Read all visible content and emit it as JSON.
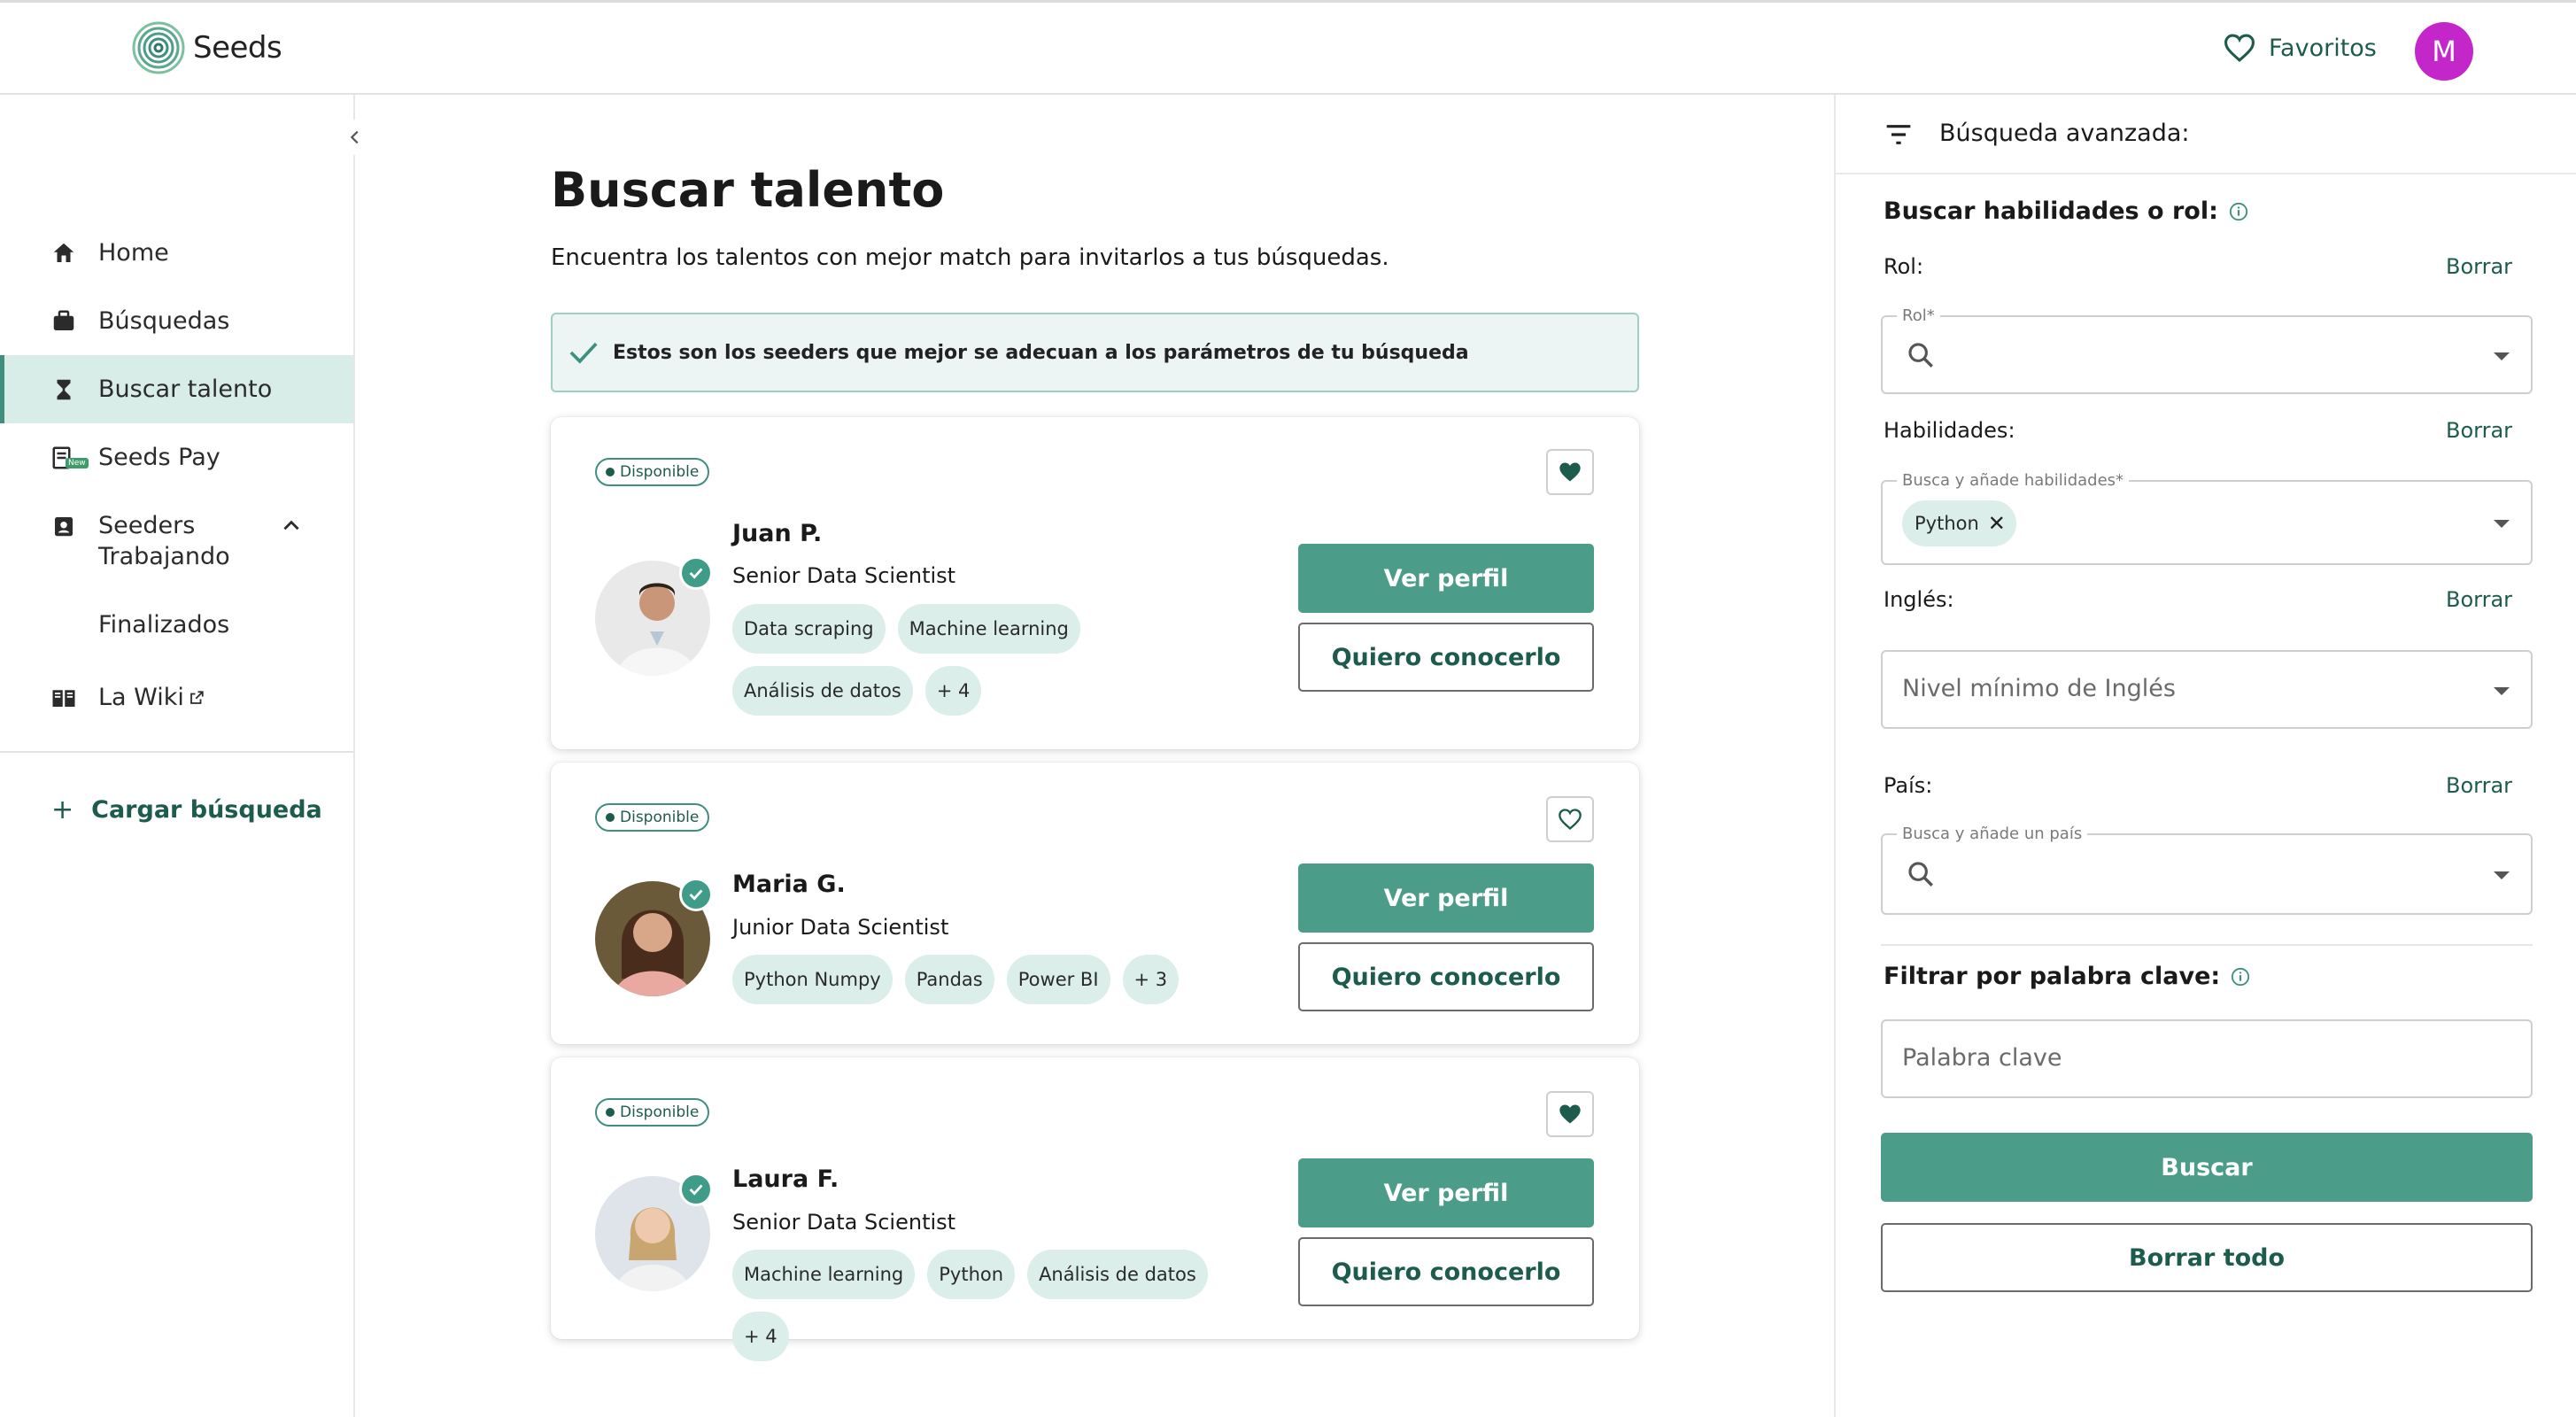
{
  "brand": {
    "name": "Seeds",
    "accent": "#4b9c89",
    "dark_green": "#1d5c4d",
    "avatar_color": "#c326c9"
  },
  "header": {
    "favorites_label": "Favoritos",
    "user_initial": "M"
  },
  "sidebar": {
    "items": [
      {
        "label": "Home",
        "icon": "home-icon"
      },
      {
        "label": "Búsquedas",
        "icon": "briefcase-icon"
      },
      {
        "label": "Buscar talento",
        "icon": "talent-icon",
        "active": true
      },
      {
        "label": "Seeds Pay",
        "icon": "seeds-pay-icon",
        "badge": "New"
      },
      {
        "label": "Seeders",
        "icon": "badge-icon",
        "expanded": true
      },
      {
        "label": "La Wiki",
        "icon": "book-icon"
      }
    ],
    "sub_items": [
      "Trabajando",
      "Finalizados"
    ],
    "load_search": "Cargar búsqueda"
  },
  "main": {
    "title": "Buscar talento",
    "subtitle": "Encuentra los talentos con mejor match para invitarlos a tus búsquedas.",
    "notice": "Estos son los seeders que mejor se adecuan a los parámetros de tu búsqueda",
    "cards": [
      {
        "status": "Disponible",
        "name": "Juan P.",
        "role": "Senior Data Scientist",
        "skills": [
          "Data scraping",
          "Machine learning",
          "Análisis de datos",
          "+ 4"
        ],
        "favorite": true,
        "view_label": "Ver perfil",
        "meet_label": "Quiero conocerlo"
      },
      {
        "status": "Disponible",
        "name": "Maria G.",
        "role": "Junior Data Scientist",
        "skills": [
          "Python Numpy",
          "Pandas",
          "Power BI",
          "+ 3"
        ],
        "favorite": false,
        "view_label": "Ver perfil",
        "meet_label": "Quiero conocerlo"
      },
      {
        "status": "Disponible",
        "name": "Laura F.",
        "role": "Senior Data Scientist",
        "skills": [
          "Machine learning",
          "Python",
          "Análisis de datos",
          "+ 4"
        ],
        "favorite": true,
        "view_label": "Ver perfil",
        "meet_label": "Quiero conocerlo"
      }
    ]
  },
  "filters": {
    "title": "Búsqueda avanzada:",
    "skills_section": "Buscar habilidades o rol:",
    "role": {
      "label": "Rol:",
      "clear": "Borrar",
      "legend": "Rol*"
    },
    "skills": {
      "label": "Habilidades:",
      "clear": "Borrar",
      "legend": "Busca y añade habilidades*",
      "tags": [
        "Python"
      ]
    },
    "english": {
      "label": "Inglés:",
      "clear": "Borrar",
      "placeholder": "Nivel mínimo de Inglés"
    },
    "country": {
      "label": "País:",
      "clear": "Borrar",
      "legend": "Busca y añade un país"
    },
    "keyword": {
      "section": "Filtrar por palabra clave:",
      "placeholder": "Palabra clave"
    },
    "search_button": "Buscar",
    "clear_all_button": "Borrar todo"
  }
}
